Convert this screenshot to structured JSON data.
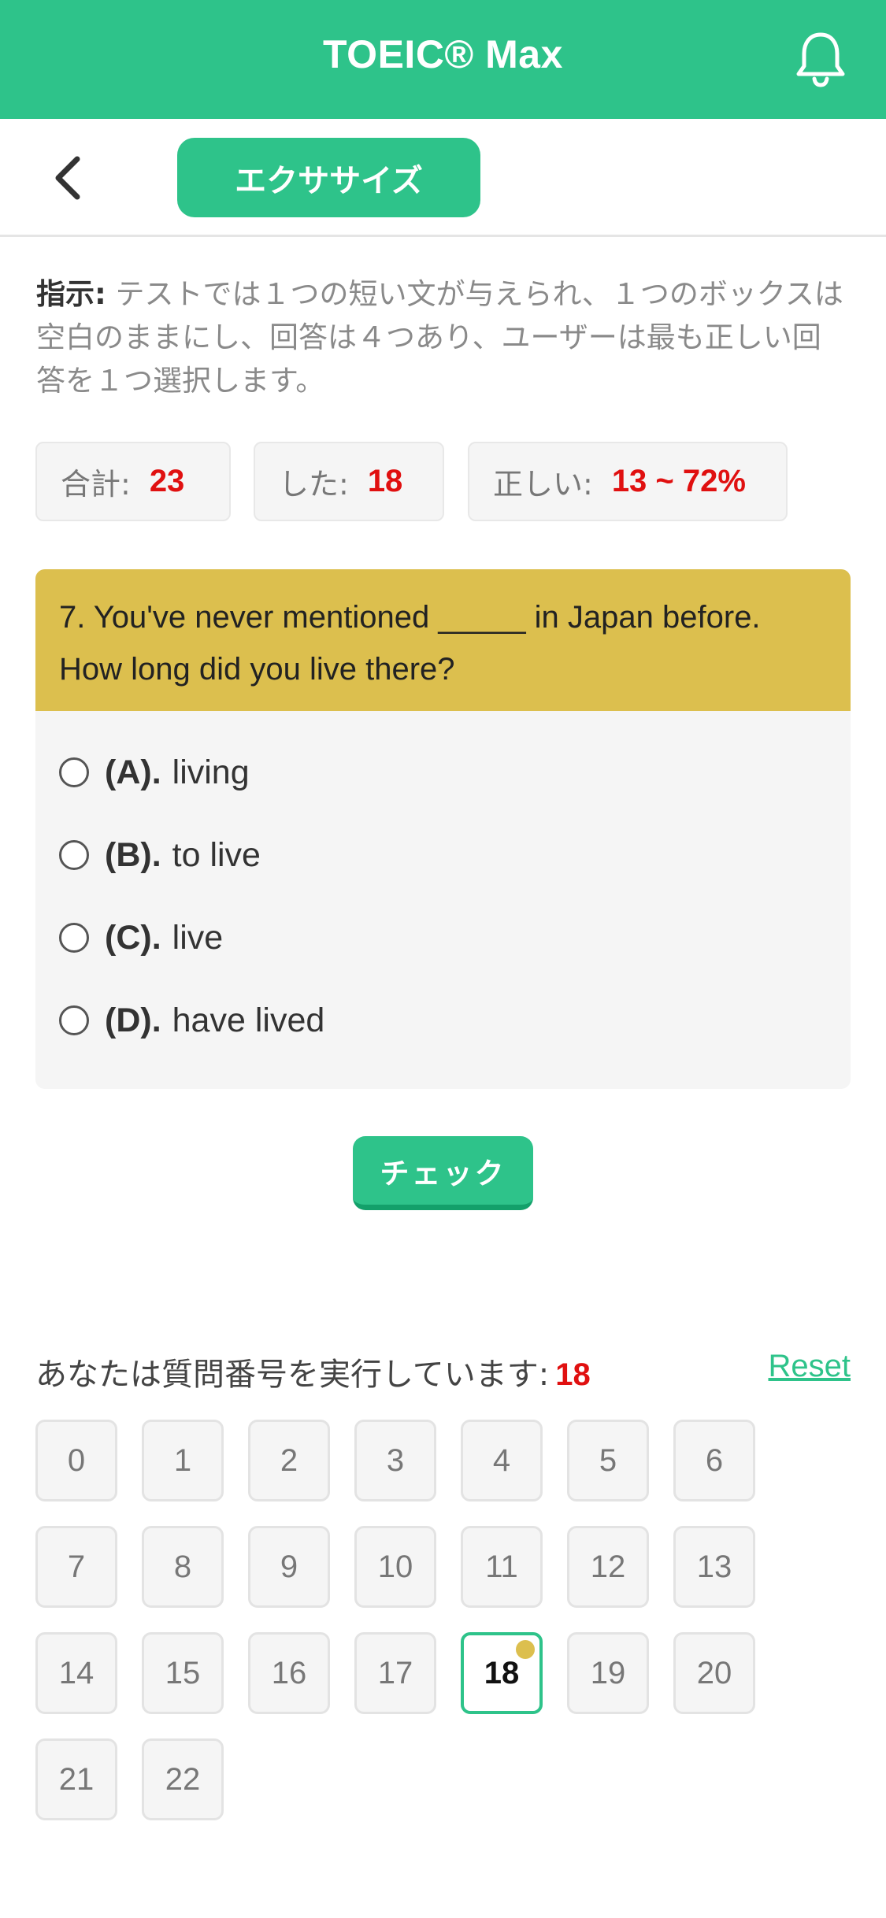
{
  "header": {
    "title": "TOEIC® Max"
  },
  "subnav": {
    "tab_label": "エクササイズ"
  },
  "instruction": {
    "label": "指示:",
    "text": " テストでは１つの短い文が与えられ、１つのボックスは空白のままにし、回答は４つあり、ユーザーは最も正しい回答を１つ選択します。"
  },
  "stats": {
    "total_label": "合計:",
    "total_value": "23",
    "done_label": "した:",
    "done_value": "18",
    "correct_label": "正しい:",
    "correct_value": "13 ~ 72%"
  },
  "question": {
    "text": "7. You've never mentioned _____ in Japan before. How long did you live there?",
    "options": [
      {
        "key": "(A).",
        "text": "living"
      },
      {
        "key": "(B).",
        "text": "to live"
      },
      {
        "key": "(C).",
        "text": "live"
      },
      {
        "key": "(D).",
        "text": "have lived"
      }
    ]
  },
  "check_label": "チェック",
  "progress": {
    "label": "あなたは質問番号を実行しています:",
    "current": "18",
    "reset_label": "Reset"
  },
  "question_numbers": [
    "0",
    "1",
    "2",
    "3",
    "4",
    "5",
    "6",
    "7",
    "8",
    "9",
    "10",
    "11",
    "12",
    "13",
    "14",
    "15",
    "16",
    "17",
    "18",
    "19",
    "20",
    "21",
    "22"
  ],
  "colors": {
    "accent": "#2ec38a",
    "question_bar": "#dcbf4e",
    "highlight": "#e01010"
  }
}
